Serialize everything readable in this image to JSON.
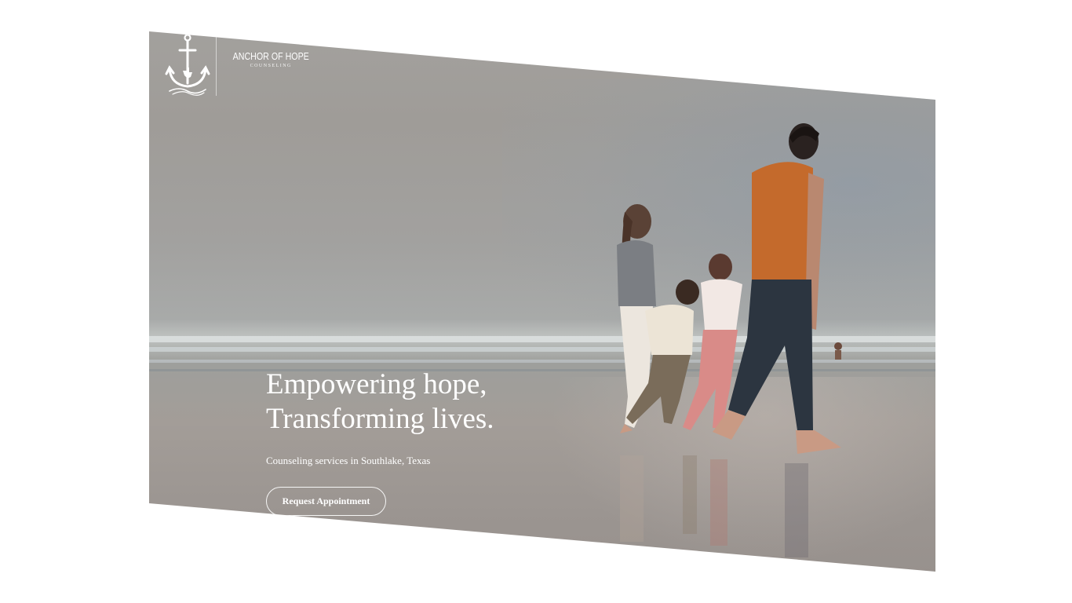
{
  "brand": {
    "name": "ANCHOR OF HOPE",
    "subtitle": "COUNSELING"
  },
  "hero": {
    "headline_line1": "Empowering hope,",
    "headline_line2": "Transforming lives.",
    "subtitle": "Counseling services in Southlake, Texas",
    "cta_label": "Request Appointment"
  },
  "icons": {
    "logo": "anchor-icon",
    "emblem": "texas-star"
  },
  "colors": {
    "text": "#ffffff",
    "overlay": "#9d9995",
    "shirt": "#c46a2c",
    "jeans": "#2c3540"
  }
}
